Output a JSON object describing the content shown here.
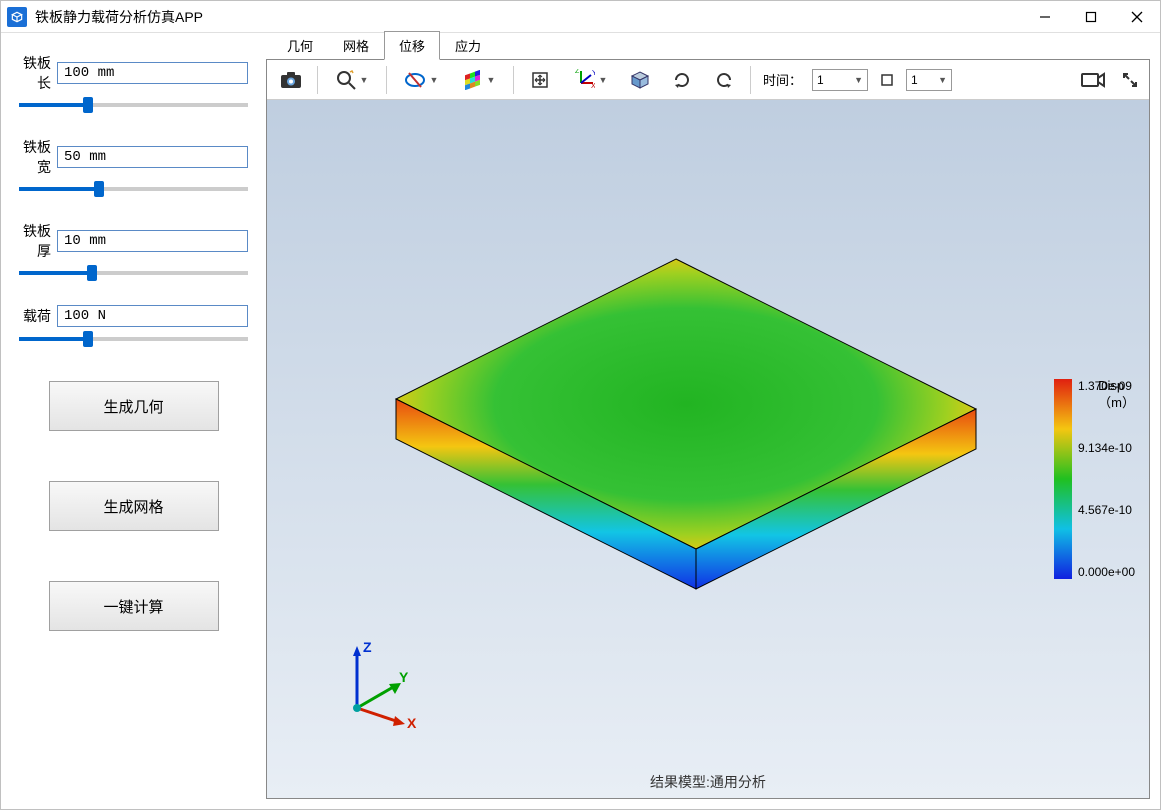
{
  "window": {
    "title": "铁板静力载荷分析仿真APP"
  },
  "sidebar": {
    "params": [
      {
        "label": "铁板长",
        "value": "100 mm",
        "fill_pct": 30
      },
      {
        "label": "铁板宽",
        "value": "50 mm",
        "fill_pct": 35
      },
      {
        "label": "铁板厚",
        "value": "10 mm",
        "fill_pct": 32
      },
      {
        "label": "载荷",
        "value": "100 N",
        "fill_pct": 30
      }
    ],
    "actions": {
      "generate_geometry": "生成几何",
      "generate_mesh": "生成网格",
      "compute": "一键计算"
    }
  },
  "tabs": {
    "geometry": "几何",
    "mesh": "网格",
    "displacement": "位移",
    "stress": "应力",
    "active": "displacement"
  },
  "toolbar": {
    "time_label": "时间：",
    "time_value": "1",
    "step_value": "1"
  },
  "viewport": {
    "caption": "结果模型:通用分析",
    "axes": {
      "x": "X",
      "y": "Y",
      "z": "Z"
    }
  },
  "legend": {
    "title_line1": "Disp",
    "title_line2": "（m）",
    "ticks": [
      "1.370e-09",
      "9.134e-10",
      "4.567e-10",
      "0.000e+00"
    ]
  },
  "chart_data": {
    "type": "heatmap",
    "title": "Disp (m)",
    "legend_ticks": [
      1.37e-09,
      9.134e-10,
      4.567e-10,
      0.0
    ],
    "value_range": [
      0.0,
      1.37e-09
    ],
    "colormap": "jet"
  }
}
